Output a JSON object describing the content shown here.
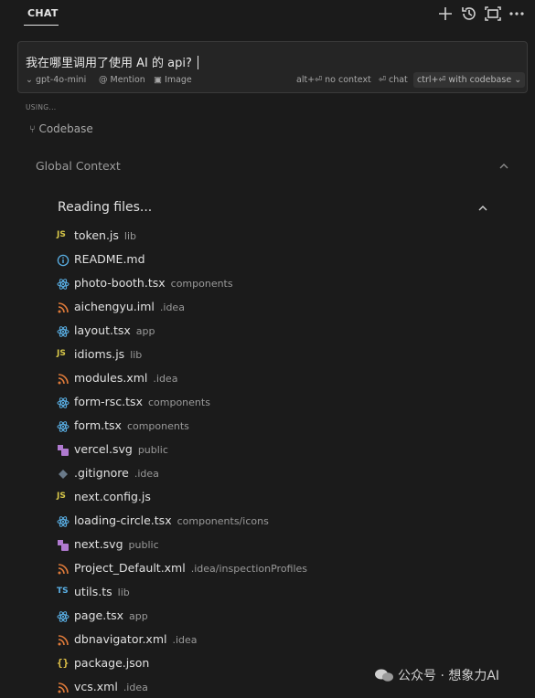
{
  "header": {
    "tab_label": "CHAT",
    "icons": [
      "plus-icon",
      "history-icon",
      "expand-icon",
      "more-icon"
    ]
  },
  "input": {
    "query": "我在哪里调用了使用 AI 的 api?",
    "model": "gpt-4o-mini",
    "mention": "Mention",
    "image": "Image",
    "no_context": "alt+⏎ no context",
    "chat": "⏎ chat",
    "with_codebase": "ctrl+⏎ with codebase"
  },
  "context": {
    "using_label": "USING...",
    "codebase_label": "Codebase",
    "global_label": "Global Context",
    "reading_label": "Reading files..."
  },
  "files": [
    {
      "name": "token.js",
      "dir": "lib",
      "type": "js"
    },
    {
      "name": "README.md",
      "dir": "",
      "type": "info"
    },
    {
      "name": "photo-booth.tsx",
      "dir": "components",
      "type": "react"
    },
    {
      "name": "aichengyu.iml",
      "dir": ".idea",
      "type": "rss"
    },
    {
      "name": "layout.tsx",
      "dir": "app",
      "type": "react"
    },
    {
      "name": "idioms.js",
      "dir": "lib",
      "type": "js"
    },
    {
      "name": "modules.xml",
      "dir": ".idea",
      "type": "rss"
    },
    {
      "name": "form-rsc.tsx",
      "dir": "components",
      "type": "react"
    },
    {
      "name": "form.tsx",
      "dir": "components",
      "type": "react"
    },
    {
      "name": "vercel.svg",
      "dir": "public",
      "type": "svg"
    },
    {
      "name": ".gitignore",
      "dir": ".idea",
      "type": "git"
    },
    {
      "name": "next.config.js",
      "dir": "",
      "type": "js"
    },
    {
      "name": "loading-circle.tsx",
      "dir": "components/icons",
      "type": "react"
    },
    {
      "name": "next.svg",
      "dir": "public",
      "type": "svg"
    },
    {
      "name": "Project_Default.xml",
      "dir": ".idea/inspectionProfiles",
      "type": "rss"
    },
    {
      "name": "utils.ts",
      "dir": "lib",
      "type": "ts"
    },
    {
      "name": "page.tsx",
      "dir": "app",
      "type": "react"
    },
    {
      "name": "dbnavigator.xml",
      "dir": ".idea",
      "type": "rss"
    },
    {
      "name": "package.json",
      "dir": "",
      "type": "json"
    },
    {
      "name": "vcs.xml",
      "dir": ".idea",
      "type": "rss"
    }
  ],
  "watermark": "公众号 · 想象力AI",
  "colors": {
    "background": "#1b1b1b",
    "js": "#d8c84a",
    "ts": "#5ab0e6",
    "react": "#5ab0e6",
    "rss": "#e07b3a",
    "svg": "#b07ad0"
  }
}
